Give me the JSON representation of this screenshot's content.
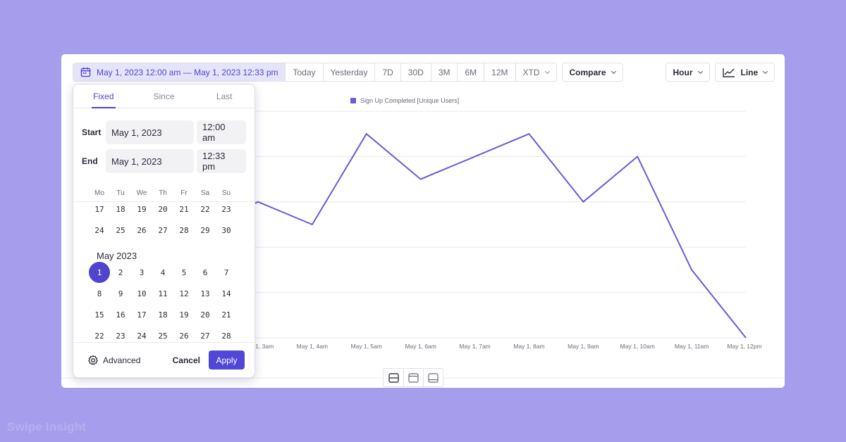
{
  "toolbar": {
    "date_range": "May 1, 2023 12:00 am — May 1, 2023 12:33 pm",
    "presets": [
      "Today",
      "Yesterday",
      "7D",
      "30D",
      "3M",
      "6M",
      "12M",
      "XTD"
    ],
    "compare_label": "Compare",
    "interval_label": "Hour",
    "chart_type_label": "Line"
  },
  "legend": {
    "label": "Sign Up Completed [Unique Users]",
    "color": "#6a5bd8"
  },
  "date_picker": {
    "tabs": [
      "Fixed",
      "Since",
      "Last"
    ],
    "active_tab": "Fixed",
    "start_label": "Start",
    "start_date": "May 1, 2023",
    "start_time": "12:00 am",
    "end_label": "End",
    "end_date": "May 1, 2023",
    "end_time": "12:33 pm",
    "weekdays": [
      "Mo",
      "Tu",
      "We",
      "Th",
      "Fr",
      "Sa",
      "Su"
    ],
    "prev_rows": [
      [
        "17",
        "18",
        "19",
        "20",
        "21",
        "22",
        "23"
      ],
      [
        "24",
        "25",
        "26",
        "27",
        "28",
        "29",
        "30"
      ]
    ],
    "month_label": "May 2023",
    "month_rows": [
      [
        "1",
        "2",
        "3",
        "4",
        "5",
        "6",
        "7"
      ],
      [
        "8",
        "9",
        "10",
        "11",
        "12",
        "13",
        "14"
      ],
      [
        "15",
        "16",
        "17",
        "18",
        "19",
        "20",
        "21"
      ],
      [
        "22",
        "23",
        "24",
        "25",
        "26",
        "27",
        "28"
      ]
    ],
    "selected_day": "1",
    "advanced_label": "Advanced",
    "cancel_label": "Cancel",
    "apply_label": "Apply"
  },
  "chart_data": {
    "type": "line",
    "x": [
      "May 1, 3am",
      "May 1, 4am",
      "May 1, 5am",
      "May 1, 6am",
      "May 1, 7am",
      "May 1, 8am",
      "May 1, 9am",
      "May 1, 10am",
      "May 1, 11am",
      "May 1, 12pm"
    ],
    "series": [
      {
        "name": "Sign Up Completed [Unique Users]",
        "values": [
          3.0,
          2.5,
          4.5,
          3.5,
          4.0,
          4.5,
          3.0,
          4.0,
          1.5,
          0.0
        ]
      }
    ],
    "ylim": [
      0,
      5
    ],
    "grid": true,
    "color": "#6a5bd8"
  },
  "view_switch": [
    "split-view-icon",
    "top-panel-icon",
    "bottom-panel-icon"
  ],
  "watermark": "Swipe Insight"
}
